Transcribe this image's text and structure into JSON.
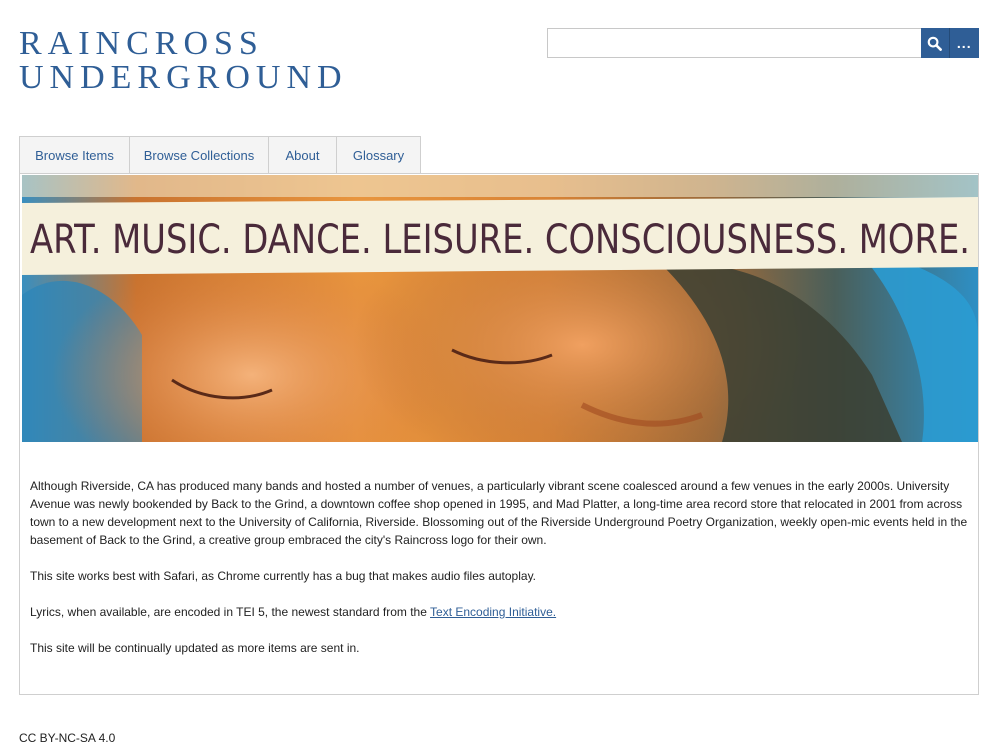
{
  "site": {
    "title_line1": "RAINCROSS",
    "title_line2": "UNDERGROUND"
  },
  "search": {
    "placeholder": "",
    "value": "",
    "search_icon": "search-icon",
    "advanced_label": "..."
  },
  "nav": {
    "items": [
      {
        "label": "Browse Items"
      },
      {
        "label": "Browse Collections"
      },
      {
        "label": "About"
      },
      {
        "label": "Glossary"
      }
    ]
  },
  "banner": {
    "painted_text": "ART. MUSIC. DANCE. LEISURE. CONSCIOUSNESS. MORE."
  },
  "content": {
    "paragraph1": "Although Riverside, CA has produced many bands and hosted a number of venues, a particularly vibrant scene coalesced around a few venues in the early 2000s. University Avenue was newly bookended by Back to the Grind, a downtown coffee shop opened in 1995, and Mad Platter, a long-time area record store that relocated in 2001 from across town to a new development next to the University of California, Riverside. Blossoming out of the Riverside Underground Poetry Organization, weekly open-mic events held in the basement of Back to the Grind, a creative group embraced the city's Raincross logo for their own.",
    "paragraph2": "This site works best with Safari, as Chrome currently has a bug that makes audio files autoplay.",
    "paragraph3_prefix": "Lyrics, when available, are encoded in TEI 5, the newest standard from the ",
    "paragraph3_link": "Text Encoding Initiative.",
    "paragraph4": "This site will be continually updated as more items are sent in."
  },
  "footer": {
    "license": "CC BY-NC-SA 4.0"
  },
  "colors": {
    "brand": "#2f5e96",
    "nav_bg": "#f4f4f4",
    "border": "#cfcfcf"
  }
}
